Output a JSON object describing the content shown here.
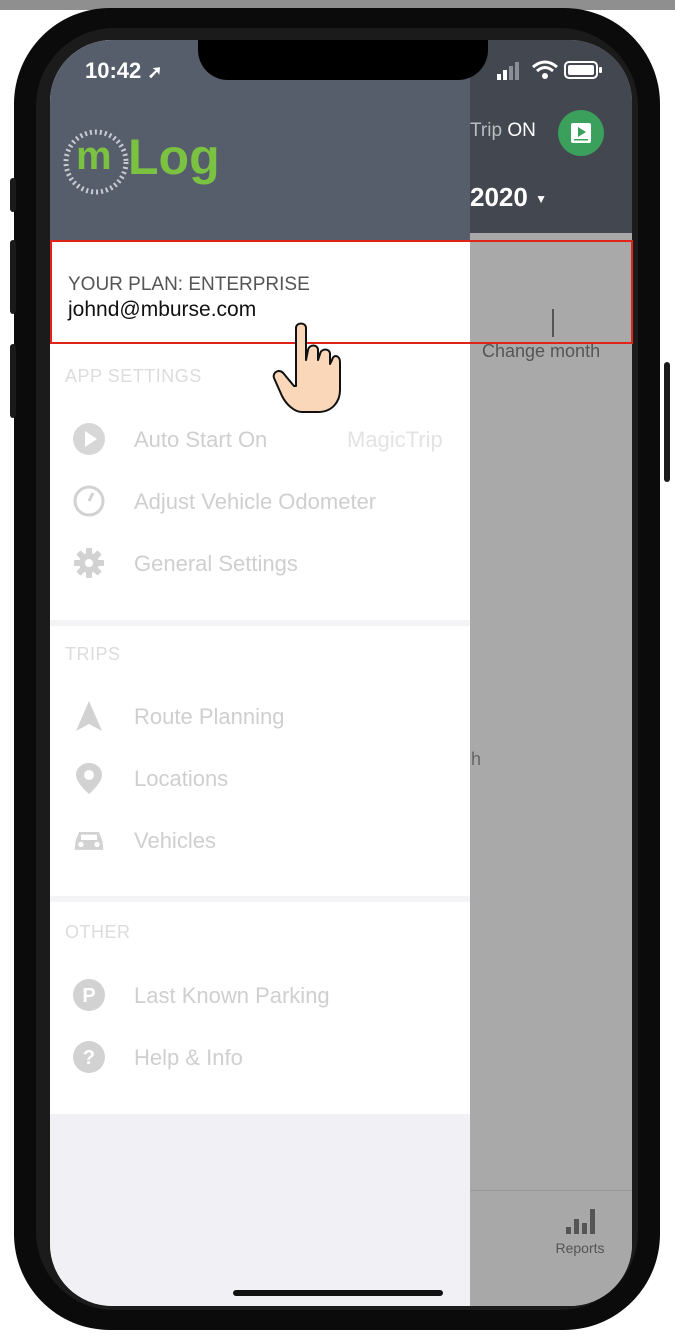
{
  "status_bar": {
    "time": "10:42"
  },
  "header": {
    "magic_trip_label": "Trip",
    "magic_trip_state": "ON",
    "year_label": "2020"
  },
  "content": {
    "change_month": "Change month",
    "partial_text": "h"
  },
  "tabbar": {
    "reports_label": "Reports"
  },
  "drawer": {
    "logo": {
      "m": "m",
      "log": "Log"
    },
    "plan_label": "YOUR PLAN: ENTERPRISE",
    "email": "johnd@mburse.com",
    "sections": [
      {
        "title": "APP SETTINGS",
        "items": [
          {
            "label": "Auto Start On",
            "extra": "MagicTrip",
            "icon": "play-icon"
          },
          {
            "label": "Adjust Vehicle Odometer",
            "icon": "odometer-icon"
          },
          {
            "label": "General Settings",
            "icon": "gear-icon"
          }
        ]
      },
      {
        "title": "TRIPS",
        "items": [
          {
            "label": "Route Planning",
            "icon": "navigation-arrow-icon"
          },
          {
            "label": "Locations",
            "icon": "location-pin-icon"
          },
          {
            "label": "Vehicles",
            "icon": "car-icon"
          }
        ]
      },
      {
        "title": "OTHER",
        "items": [
          {
            "label": "Last Known Parking",
            "icon": "parking-icon"
          },
          {
            "label": "Help & Info",
            "icon": "help-icon"
          }
        ]
      }
    ]
  },
  "colors": {
    "highlight": "#e0241a",
    "logo_green": "#7cc242",
    "header_bg": "#424750",
    "drawer_header_bg": "#565e6b",
    "video_icon_bg": "#3aa05c"
  }
}
